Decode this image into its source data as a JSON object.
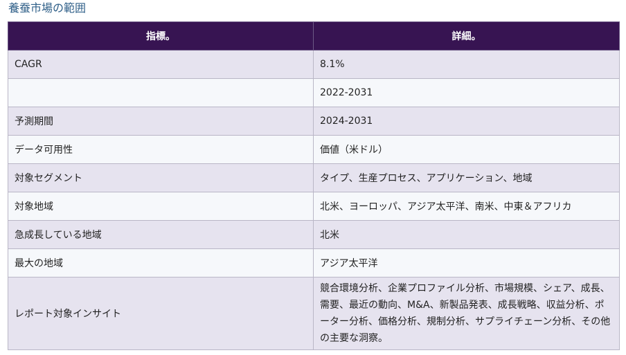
{
  "heading": "養蚕市場の範囲",
  "table": {
    "headers": [
      "指標。",
      "詳細。"
    ],
    "rows": [
      {
        "metric": "CAGR",
        "detail": "8.1%"
      },
      {
        "metric": "",
        "detail": "2022-2031"
      },
      {
        "metric": "予測期間",
        "detail": "2024-2031"
      },
      {
        "metric": "データ可用性",
        "detail": "価値（米ドル）"
      },
      {
        "metric": "対象セグメント",
        "detail": "タイプ、生産プロセス、アプリケーション、地域"
      },
      {
        "metric": "対象地域",
        "detail": "北米、ヨーロッパ、アジア太平洋、南米、中東＆アフリカ"
      },
      {
        "metric": "急成長している地域",
        "detail": "北米"
      },
      {
        "metric": "最大の地域",
        "detail": "アジア太平洋"
      },
      {
        "metric": "レポート対象インサイト",
        "detail": "競合環境分析、企業プロファイル分析、市場規模、シェア、成長、需要、最近の動向、M&A、新製品発表、成長戦略、収益分析、ポーター分析、価格分析、規制分析、サプライチェーン分析、その他の主要な洞察。"
      }
    ]
  }
}
